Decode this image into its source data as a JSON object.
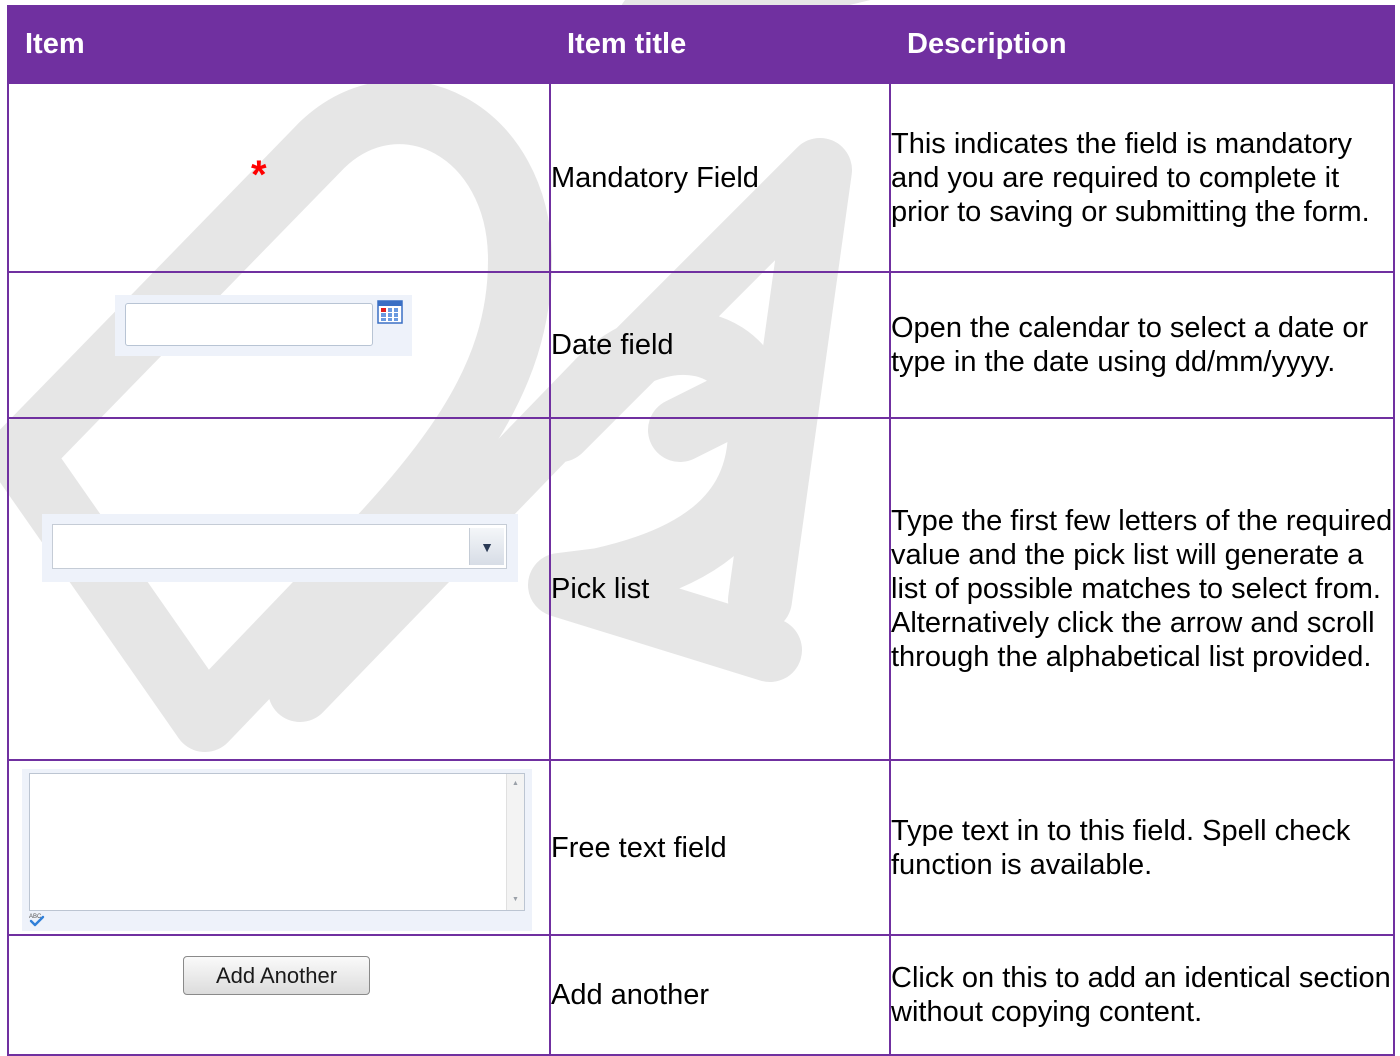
{
  "table": {
    "headers": {
      "item": "Item",
      "title": "Item title",
      "description": "Description"
    },
    "rows": [
      {
        "icon": "red-asterisk-icon",
        "title": "Mandatory Field",
        "description": "This indicates the field is mandatory and you are required to complete it prior to saving or submitting the form."
      },
      {
        "icon": "calendar-icon",
        "title": "Date field",
        "description": "Open the calendar to select a date or type in the date using dd/mm/yyyy."
      },
      {
        "icon": "dropdown-arrow-icon",
        "title": "Pick list",
        "description": "Type the first few letters of the required value and the pick list will generate a list of possible matches to select from. Alternatively click the arrow and scroll through the alphabetical list provided."
      },
      {
        "icon": "spell-check-icon",
        "title": "Free text field",
        "description": "Type text in to this field. Spell check function is available."
      },
      {
        "title": "Add another",
        "description": "Click on this to add an identical section without copying content.",
        "button_label": "Add Another"
      }
    ]
  },
  "colors": {
    "header_bg": "#7030a0",
    "border": "#7030a0",
    "asterisk": "#ff0000",
    "watermark": "#e6e6e6"
  },
  "watermark_text": "DRAFT"
}
